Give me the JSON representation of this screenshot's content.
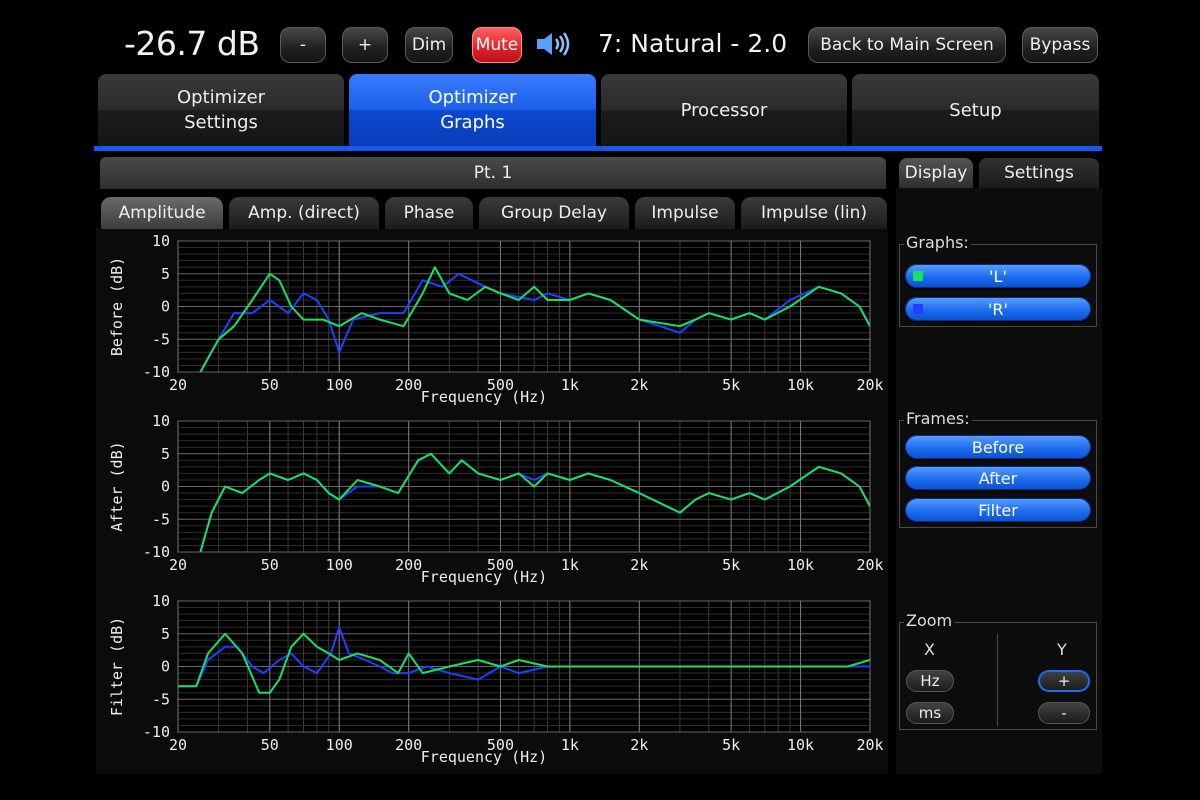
{
  "topbar": {
    "volume": "-26.7 dB",
    "minus_label": "-",
    "plus_label": "+",
    "dim_label": "Dim",
    "mute_label": "Mute",
    "speaker_icon": "speaker-volume-icon",
    "preset": "7: Natural - 2.0",
    "back_label": "Back to Main Screen",
    "bypass_label": "Bypass"
  },
  "main_tabs": [
    {
      "line1": "Optimizer",
      "line2": "Settings"
    },
    {
      "line1": "Optimizer",
      "line2": "Graphs"
    },
    {
      "line1": "Processor",
      "line2": ""
    },
    {
      "line1": "Setup",
      "line2": ""
    }
  ],
  "point_label": "Pt. 1",
  "sub_tabs": [
    "Amplitude",
    "Amp. (direct)",
    "Phase",
    "Group Delay",
    "Impulse",
    "Impulse (lin)"
  ],
  "right_tabs": [
    "Display",
    "Settings"
  ],
  "graphs_group": {
    "title": "Graphs:",
    "items": [
      {
        "label": "'L'",
        "color": "#18e060"
      },
      {
        "label": "'R'",
        "color": "#2040ff"
      }
    ]
  },
  "frames_group": {
    "title": "Frames:",
    "items": [
      "Before",
      "After",
      "Filter"
    ]
  },
  "zoom_group": {
    "title": "Zoom",
    "x_label": "X",
    "y_label": "Y",
    "x_buttons": [
      "Hz",
      "ms"
    ],
    "y_buttons": [
      "+",
      "-"
    ]
  },
  "colors": {
    "left_series": "#18e060",
    "right_series": "#2040ff",
    "accent": "#1658f0"
  },
  "chart_data": [
    {
      "type": "line",
      "ylabel": "Before (dB)",
      "xlabel": "Frequency (Hz)",
      "xscale": "log",
      "xlim": [
        20,
        20000
      ],
      "ylim": [
        -10,
        10
      ],
      "xticks": [
        "20",
        "50",
        "100",
        "200",
        "500",
        "1k",
        "2k",
        "5k",
        "10k",
        "20k"
      ],
      "yticks": [
        "10",
        "5",
        "0",
        "-5",
        "-10"
      ],
      "grid": true,
      "series": [
        {
          "name": "'L'",
          "color": "#18e060",
          "points": [
            [
              25,
              -10
            ],
            [
              30,
              -5
            ],
            [
              35,
              -3
            ],
            [
              42,
              1
            ],
            [
              50,
              5
            ],
            [
              55,
              4
            ],
            [
              62,
              0
            ],
            [
              70,
              -2
            ],
            [
              85,
              -2
            ],
            [
              100,
              -3
            ],
            [
              125,
              -1
            ],
            [
              150,
              -2
            ],
            [
              190,
              -3
            ],
            [
              230,
              2
            ],
            [
              260,
              6
            ],
            [
              300,
              2
            ],
            [
              360,
              1
            ],
            [
              430,
              3
            ],
            [
              500,
              2
            ],
            [
              600,
              1
            ],
            [
              700,
              3
            ],
            [
              800,
              1
            ],
            [
              1000,
              1
            ],
            [
              1200,
              2
            ],
            [
              1500,
              1
            ],
            [
              2000,
              -2
            ],
            [
              3000,
              -3
            ],
            [
              3500,
              -2
            ],
            [
              4000,
              -1
            ],
            [
              5000,
              -2
            ],
            [
              6000,
              -1
            ],
            [
              7000,
              -2
            ],
            [
              9000,
              0
            ],
            [
              12000,
              3
            ],
            [
              15000,
              2
            ],
            [
              18000,
              0
            ],
            [
              20000,
              -3
            ]
          ]
        },
        {
          "name": "'R'",
          "color": "#2040ff",
          "points": [
            [
              25,
              -10
            ],
            [
              30,
              -5
            ],
            [
              35,
              -1
            ],
            [
              42,
              -1
            ],
            [
              50,
              1
            ],
            [
              60,
              -1
            ],
            [
              70,
              2
            ],
            [
              80,
              1
            ],
            [
              90,
              -2
            ],
            [
              100,
              -7
            ],
            [
              115,
              -2
            ],
            [
              150,
              -1
            ],
            [
              190,
              -1
            ],
            [
              230,
              4
            ],
            [
              280,
              3
            ],
            [
              330,
              5
            ],
            [
              430,
              3
            ],
            [
              500,
              2
            ],
            [
              700,
              1
            ],
            [
              800,
              2
            ],
            [
              1000,
              1
            ],
            [
              1200,
              2
            ],
            [
              1500,
              1
            ],
            [
              2000,
              -2
            ],
            [
              3000,
              -4
            ],
            [
              3500,
              -2
            ],
            [
              4000,
              -1
            ],
            [
              5000,
              -2
            ],
            [
              6000,
              -1
            ],
            [
              7000,
              -2
            ],
            [
              9000,
              1
            ],
            [
              12000,
              3
            ],
            [
              15000,
              2
            ],
            [
              18000,
              0
            ],
            [
              20000,
              -3
            ]
          ]
        }
      ]
    },
    {
      "type": "line",
      "ylabel": "After (dB)",
      "xlabel": "Frequency (Hz)",
      "xscale": "log",
      "xlim": [
        20,
        20000
      ],
      "ylim": [
        -10,
        10
      ],
      "xticks": [
        "20",
        "50",
        "100",
        "200",
        "500",
        "1k",
        "2k",
        "5k",
        "10k",
        "20k"
      ],
      "yticks": [
        "10",
        "5",
        "0",
        "-5",
        "-10"
      ],
      "grid": true,
      "series": [
        {
          "name": "'L'",
          "color": "#18e060",
          "points": [
            [
              25,
              -10
            ],
            [
              28,
              -4
            ],
            [
              32,
              0
            ],
            [
              38,
              -1
            ],
            [
              45,
              1
            ],
            [
              50,
              2
            ],
            [
              60,
              1
            ],
            [
              70,
              2
            ],
            [
              80,
              1
            ],
            [
              90,
              -1
            ],
            [
              100,
              -2
            ],
            [
              120,
              1
            ],
            [
              150,
              0
            ],
            [
              180,
              -1
            ],
            [
              220,
              4
            ],
            [
              250,
              5
            ],
            [
              300,
              2
            ],
            [
              340,
              4
            ],
            [
              400,
              2
            ],
            [
              500,
              1
            ],
            [
              600,
              2
            ],
            [
              700,
              0
            ],
            [
              800,
              2
            ],
            [
              1000,
              1
            ],
            [
              1200,
              2
            ],
            [
              1500,
              1
            ],
            [
              2000,
              -1
            ],
            [
              3000,
              -4
            ],
            [
              3500,
              -2
            ],
            [
              4000,
              -1
            ],
            [
              5000,
              -2
            ],
            [
              6000,
              -1
            ],
            [
              7000,
              -2
            ],
            [
              9000,
              0
            ],
            [
              12000,
              3
            ],
            [
              15000,
              2
            ],
            [
              18000,
              0
            ],
            [
              20000,
              -3
            ]
          ]
        },
        {
          "name": "'R'",
          "color": "#2040ff",
          "points": [
            [
              25,
              -10
            ],
            [
              28,
              -4
            ],
            [
              32,
              0
            ],
            [
              38,
              -1
            ],
            [
              45,
              1
            ],
            [
              50,
              2
            ],
            [
              60,
              1
            ],
            [
              70,
              2
            ],
            [
              80,
              1
            ],
            [
              90,
              -1
            ],
            [
              100,
              -2
            ],
            [
              120,
              0
            ],
            [
              150,
              0
            ],
            [
              180,
              -1
            ],
            [
              220,
              4
            ],
            [
              250,
              5
            ],
            [
              300,
              2
            ],
            [
              340,
              4
            ],
            [
              400,
              2
            ],
            [
              500,
              1
            ],
            [
              600,
              2
            ],
            [
              700,
              1
            ],
            [
              800,
              2
            ],
            [
              1000,
              1
            ],
            [
              1200,
              2
            ],
            [
              1500,
              1
            ],
            [
              2000,
              -1
            ],
            [
              3000,
              -4
            ],
            [
              3500,
              -2
            ],
            [
              4000,
              -1
            ],
            [
              5000,
              -2
            ],
            [
              6000,
              -1
            ],
            [
              7000,
              -2
            ],
            [
              9000,
              0
            ],
            [
              12000,
              3
            ],
            [
              15000,
              2
            ],
            [
              18000,
              0
            ],
            [
              20000,
              -3
            ]
          ]
        }
      ]
    },
    {
      "type": "line",
      "ylabel": "Filter (dB)",
      "xlabel": "Frequency (Hz)",
      "xscale": "log",
      "xlim": [
        20,
        20000
      ],
      "ylim": [
        -10,
        10
      ],
      "xticks": [
        "20",
        "50",
        "100",
        "200",
        "500",
        "1k",
        "2k",
        "5k",
        "10k",
        "20k"
      ],
      "yticks": [
        "10",
        "5",
        "0",
        "-5",
        "-10"
      ],
      "grid": true,
      "series": [
        {
          "name": "'L'",
          "color": "#18e060",
          "points": [
            [
              20,
              -3
            ],
            [
              24,
              -3
            ],
            [
              27,
              2
            ],
            [
              32,
              5
            ],
            [
              38,
              2
            ],
            [
              45,
              -4
            ],
            [
              50,
              -4
            ],
            [
              55,
              -2
            ],
            [
              62,
              3
            ],
            [
              70,
              5
            ],
            [
              80,
              3
            ],
            [
              90,
              2
            ],
            [
              100,
              1
            ],
            [
              120,
              2
            ],
            [
              150,
              1
            ],
            [
              180,
              -1
            ],
            [
              200,
              2
            ],
            [
              230,
              -1
            ],
            [
              300,
              0
            ],
            [
              400,
              1
            ],
            [
              500,
              0
            ],
            [
              600,
              1
            ],
            [
              800,
              0
            ],
            [
              1000,
              0
            ],
            [
              1500,
              0
            ],
            [
              2000,
              0
            ],
            [
              3000,
              0
            ],
            [
              5000,
              0
            ],
            [
              8000,
              0
            ],
            [
              12000,
              0
            ],
            [
              16000,
              0
            ],
            [
              20000,
              1
            ]
          ]
        },
        {
          "name": "'R'",
          "color": "#2040ff",
          "points": [
            [
              20,
              -3
            ],
            [
              24,
              -3
            ],
            [
              27,
              1
            ],
            [
              32,
              3
            ],
            [
              36,
              3
            ],
            [
              42,
              0
            ],
            [
              47,
              -1
            ],
            [
              55,
              1
            ],
            [
              62,
              2
            ],
            [
              70,
              0
            ],
            [
              80,
              -1
            ],
            [
              92,
              2
            ],
            [
              100,
              6
            ],
            [
              110,
              2
            ],
            [
              130,
              1
            ],
            [
              150,
              0
            ],
            [
              170,
              -1
            ],
            [
              200,
              -1
            ],
            [
              240,
              0
            ],
            [
              300,
              -1
            ],
            [
              400,
              -2
            ],
            [
              500,
              0
            ],
            [
              600,
              -1
            ],
            [
              800,
              0
            ],
            [
              1000,
              0
            ],
            [
              1500,
              0
            ],
            [
              2000,
              0
            ],
            [
              3000,
              0
            ],
            [
              5000,
              0
            ],
            [
              8000,
              0
            ],
            [
              12000,
              0
            ],
            [
              16000,
              0
            ],
            [
              20000,
              0
            ]
          ]
        }
      ]
    }
  ]
}
